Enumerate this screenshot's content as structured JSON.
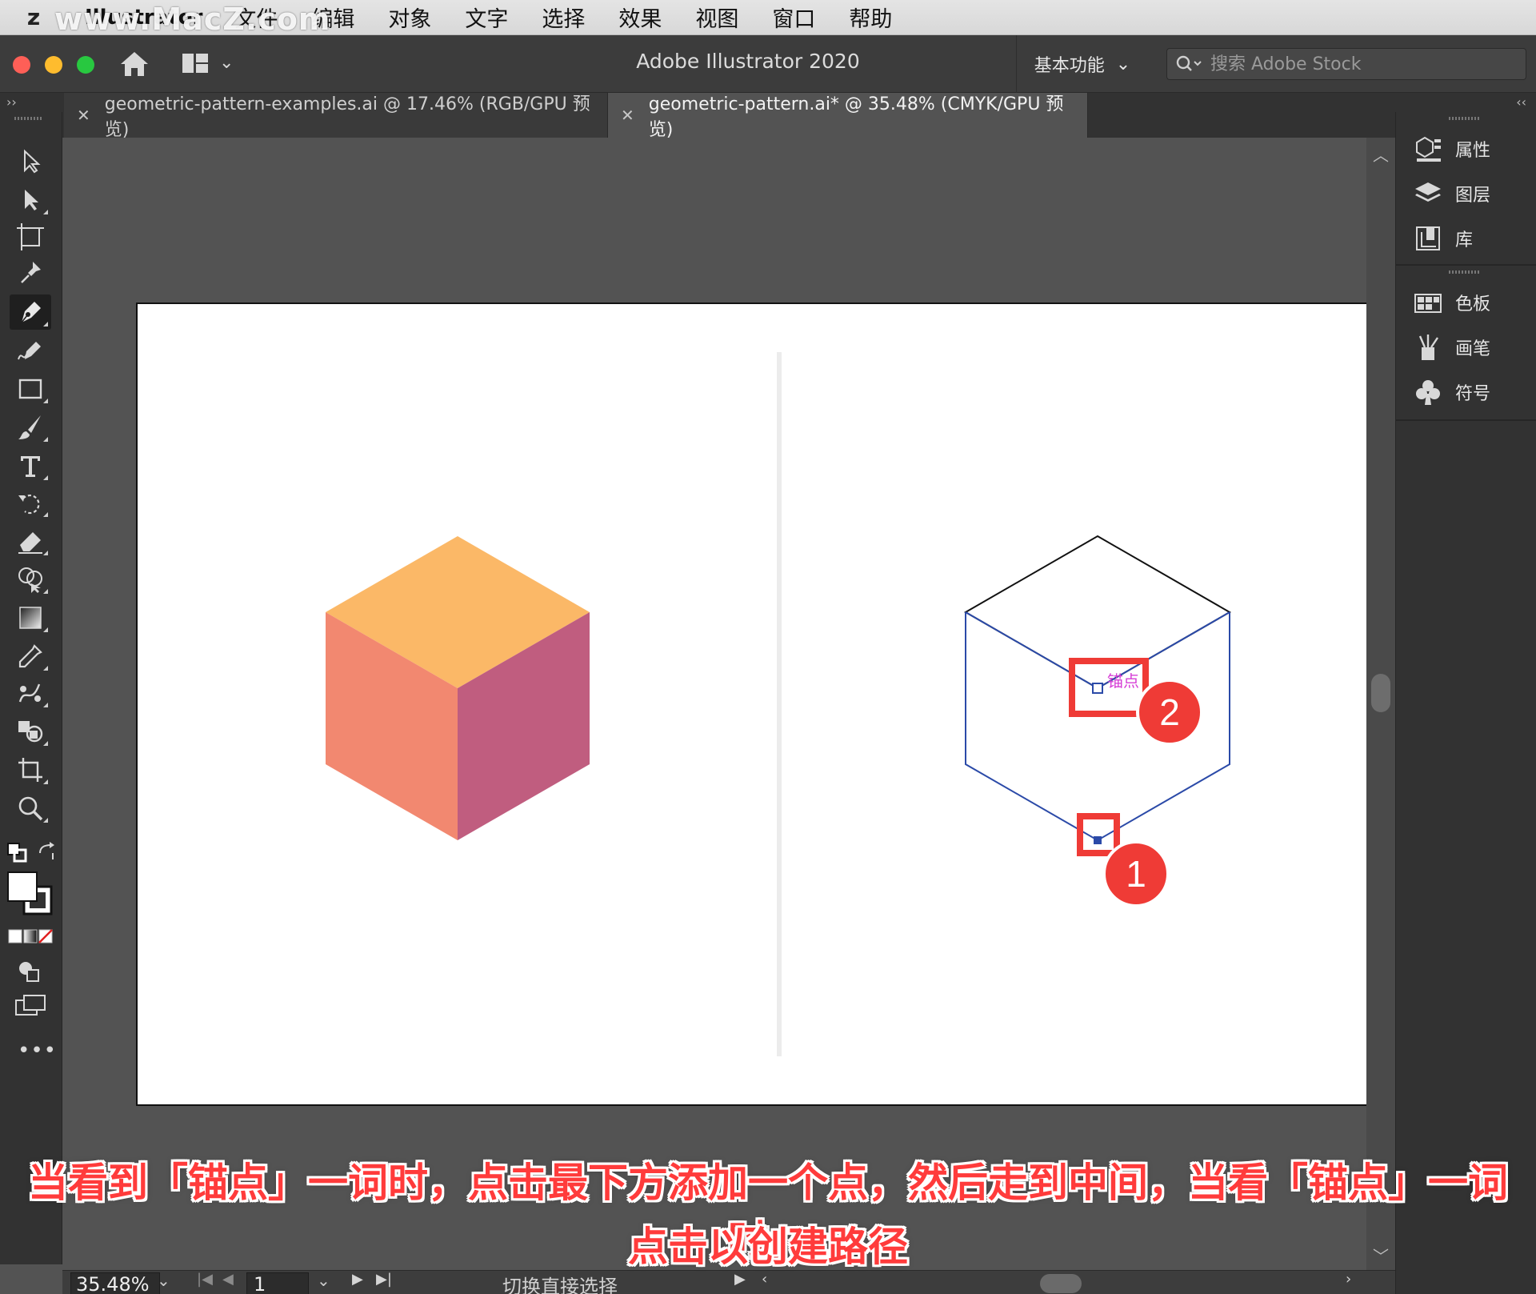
{
  "menubar": {
    "logo": "z",
    "watermark": "www.MacZ.com",
    "app_name": "Illustrator",
    "items": [
      "文件",
      "编辑",
      "对象",
      "文字",
      "选择",
      "效果",
      "视图",
      "窗口",
      "帮助"
    ]
  },
  "appbar": {
    "title": "Adobe Illustrator 2020",
    "workspace_label": "基本功能",
    "search_placeholder": "搜索 Adobe Stock"
  },
  "tabs": [
    {
      "label": "geometric-pattern-examples.ai @ 17.46% (RGB/GPU 预览)",
      "active": false
    },
    {
      "label": "geometric-pattern.ai* @ 35.48% (CMYK/GPU 预览)",
      "active": true
    }
  ],
  "toolbar": {
    "tools": [
      "selection-tool",
      "direct-selection-tool",
      "artboard-tool",
      "puppet-warp-tool",
      "pen-tool",
      "curvature-tool",
      "rectangle-tool",
      "paintbrush-tool",
      "type-tool",
      "rotate-tool",
      "eraser-tool",
      "shape-builder-tool",
      "gradient-tool",
      "eyedropper-tool",
      "blend-tool",
      "live-paint-tool",
      "crop-tool",
      "zoom-tool"
    ],
    "active_tool": "pen-tool"
  },
  "right_panel": {
    "group1": [
      "属性",
      "图层",
      "库"
    ],
    "group2": [
      "色板",
      "画笔",
      "符号"
    ]
  },
  "canvas": {
    "anchor_hint": "锚点",
    "callout1": "1",
    "callout2": "2",
    "colors": {
      "cube_top": "#fbb867",
      "cube_left": "#f28870",
      "cube_right": "#c05d7f",
      "path_blue": "#2b4aa8",
      "callout_red": "#ef3b36"
    }
  },
  "statusbar": {
    "zoom": "35.48%",
    "artboard_number": "1",
    "status_text": "切换直接选择"
  },
  "subtitle": {
    "line1": "当看到「锚点」一词时，点击最下方添加一个点，然后走到中间，当看「锚点」一词时，",
    "line2": "点击以创建路径"
  }
}
